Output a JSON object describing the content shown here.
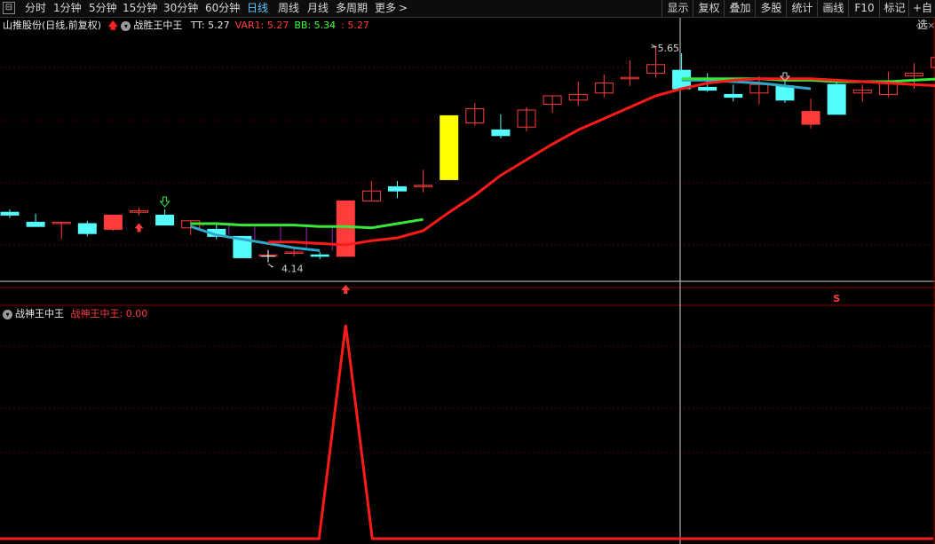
{
  "toolbar": {
    "periods": [
      "分时",
      "1分钟",
      "5分钟",
      "15分钟",
      "30分钟",
      "60分钟",
      "日线",
      "周线",
      "月线",
      "多周期",
      "更多"
    ],
    "active_period": "日线",
    "more_arrow": ">",
    "right_buttons": [
      "显示",
      "复权",
      "叠加",
      "多股",
      "统计",
      "画线",
      "F10",
      "标记",
      "+自选"
    ]
  },
  "main_panel": {
    "stock_name": "山推股份",
    "adjust_mode": "(日线,前复权)",
    "indicator_name": "战胜王中王",
    "indicators": [
      {
        "label": "TT:",
        "value": "5.27",
        "color": "#e0e0e0"
      },
      {
        "label": "VAR1:",
        "value": "5.27",
        "color": "#ff3c3c"
      },
      {
        "label": "BB:",
        "value": "5.34",
        "color": "#3cff3c"
      },
      {
        "label": ":",
        "value": "5.27",
        "color": "#ff3c3c"
      }
    ],
    "high_label": "5.65",
    "low_label": "4.14",
    "signal_letter": "S"
  },
  "sub_panel": {
    "indicator_name": "战神王中王",
    "value_label": "战神王中王:",
    "value": "0.00"
  },
  "colors": {
    "up": "#ff3c3c",
    "down": "#54fcfc",
    "ma_red": "#ff1a1a",
    "ma_green": "#38e838",
    "ma_cyan": "#2ea8c8",
    "highlight_yellow": "#ffff00",
    "grid": "#4a0000",
    "panel_border": "#8a0000"
  },
  "chart_data": {
    "type": "candlestick",
    "price_range": [
      4.0,
      5.75
    ],
    "candles": [
      {
        "o": 4.48,
        "h": 4.5,
        "l": 4.44,
        "c": 4.46
      },
      {
        "o": 4.41,
        "h": 4.47,
        "l": 4.4,
        "c": 4.38
      },
      {
        "o": 4.41,
        "h": 4.41,
        "l": 4.29,
        "c": 4.41
      },
      {
        "o": 4.4,
        "h": 4.42,
        "l": 4.31,
        "c": 4.33
      },
      {
        "o": 4.36,
        "h": 4.46,
        "l": 4.35,
        "c": 4.46
      },
      {
        "o": 4.48,
        "h": 4.51,
        "l": 4.46,
        "c": 4.49
      },
      {
        "o": 4.46,
        "h": 4.5,
        "l": 4.39,
        "c": 4.39
      },
      {
        "o": 4.37,
        "h": 4.42,
        "l": 4.32,
        "c": 4.42
      },
      {
        "o": 4.36,
        "h": 4.41,
        "l": 4.29,
        "c": 4.31
      },
      {
        "o": 4.31,
        "h": 4.31,
        "l": 4.16,
        "c": 4.16
      },
      {
        "o": 4.18,
        "h": 4.18,
        "l": 4.14,
        "c": 4.18
      },
      {
        "o": 4.2,
        "h": 4.23,
        "l": 4.17,
        "c": 4.2
      },
      {
        "o": 4.18,
        "h": 4.2,
        "l": 4.15,
        "c": 4.17
      },
      {
        "o": 4.17,
        "h": 4.56,
        "l": 4.17,
        "c": 4.56
      },
      {
        "o": 4.56,
        "h": 4.7,
        "l": 4.56,
        "c": 4.63
      },
      {
        "o": 4.66,
        "h": 4.7,
        "l": 4.58,
        "c": 4.63
      },
      {
        "o": 4.67,
        "h": 4.78,
        "l": 4.62,
        "c": 4.67
      },
      {
        "o": 4.71,
        "h": 5.16,
        "l": 4.71,
        "c": 5.16
      },
      {
        "o": 5.11,
        "h": 5.25,
        "l": 5.09,
        "c": 5.21
      },
      {
        "o": 5.06,
        "h": 5.17,
        "l": 5.0,
        "c": 5.02
      },
      {
        "o": 5.08,
        "h": 5.22,
        "l": 5.05,
        "c": 5.2
      },
      {
        "o": 5.24,
        "h": 5.3,
        "l": 5.18,
        "c": 5.3
      },
      {
        "o": 5.27,
        "h": 5.4,
        "l": 5.23,
        "c": 5.31
      },
      {
        "o": 5.32,
        "h": 5.45,
        "l": 5.29,
        "c": 5.39
      },
      {
        "o": 5.42,
        "h": 5.55,
        "l": 5.37,
        "c": 5.43
      },
      {
        "o": 5.46,
        "h": 5.65,
        "l": 5.43,
        "c": 5.52
      },
      {
        "o": 5.48,
        "h": 5.6,
        "l": 5.4,
        "c": 5.35
      },
      {
        "o": 5.36,
        "h": 5.46,
        "l": 5.33,
        "c": 5.34
      },
      {
        "o": 5.31,
        "h": 5.38,
        "l": 5.26,
        "c": 5.29
      },
      {
        "o": 5.32,
        "h": 5.44,
        "l": 5.24,
        "c": 5.38
      },
      {
        "o": 5.37,
        "h": 5.4,
        "l": 5.25,
        "c": 5.27
      },
      {
        "o": 5.19,
        "h": 5.28,
        "l": 5.07,
        "c": 5.1
      },
      {
        "o": 5.38,
        "h": 5.42,
        "l": 5.17,
        "c": 5.17
      },
      {
        "o": 5.32,
        "h": 5.38,
        "l": 5.26,
        "c": 5.34
      },
      {
        "o": 5.31,
        "h": 5.47,
        "l": 5.29,
        "c": 5.4
      },
      {
        "o": 5.44,
        "h": 5.53,
        "l": 5.35,
        "c": 5.46
      },
      {
        "o": 5.5,
        "h": 5.58,
        "l": 5.4,
        "c": 5.57
      }
    ],
    "ma_red_start": 10,
    "ma_red": [
      4.27,
      4.27,
      4.26,
      4.25,
      4.28,
      4.3,
      4.35,
      4.48,
      4.6,
      4.74,
      4.85,
      4.96,
      5.06,
      5.14,
      5.22,
      5.3,
      5.35,
      5.39,
      5.41,
      5.42,
      5.42,
      5.42,
      5.41,
      5.4,
      5.39,
      5.38,
      5.37,
      5.36,
      5.37,
      5.4,
      5.43,
      5.47
    ],
    "ma_green_start": 7,
    "ma_green": [
      4.4,
      4.4,
      4.39,
      4.39,
      4.39,
      4.38,
      4.38,
      4.37,
      4.4,
      4.43
    ],
    "ma_green2_start": 26,
    "ma_green2": [
      5.42,
      5.42,
      5.42,
      5.42,
      5.41,
      5.41,
      5.4,
      5.4,
      5.4,
      5.41,
      5.42,
      5.44
    ],
    "ma_cyan_start": 7,
    "ma_cyan": [
      4.38,
      4.32,
      4.29,
      4.26,
      4.23,
      4.21
    ],
    "ma_cyan2_start": 26,
    "ma_cyan2": [
      5.41,
      5.41,
      5.4,
      5.39,
      5.37,
      5.35
    ],
    "highlight_red": [
      4,
      13,
      31
    ],
    "highlight_yellow": [
      17
    ],
    "up_arrows": [
      5,
      13
    ],
    "green_arrow": 6,
    "hollow_arrow": 30,
    "signal_index": 32,
    "sub_values": [
      0,
      0,
      0,
      0,
      0,
      0,
      0,
      0,
      0,
      0,
      0,
      0,
      0,
      1,
      0,
      0,
      0,
      0,
      0,
      0,
      0,
      0,
      0,
      0,
      0,
      0,
      0,
      0,
      0,
      0,
      0,
      0,
      0,
      0,
      0,
      0,
      0
    ]
  }
}
